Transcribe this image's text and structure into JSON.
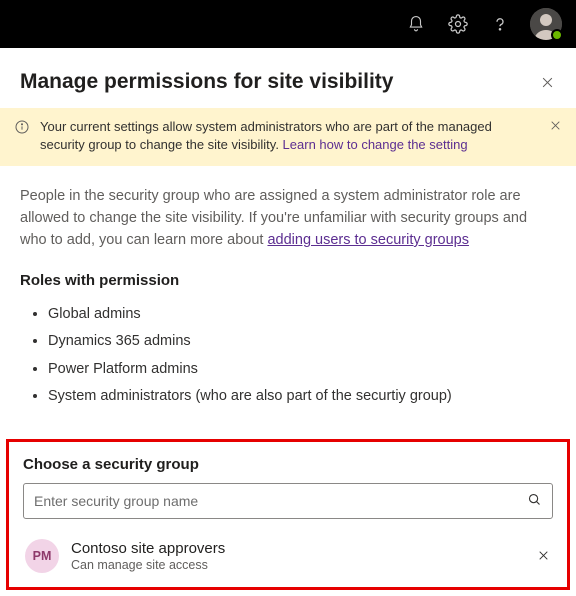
{
  "panel": {
    "title": "Manage permissions for site visibility"
  },
  "infoBar": {
    "text_before_link": "Your current settings allow system administrators who are part of the managed security group to change the site visibility. ",
    "link_text": "Learn how to change the setting"
  },
  "intro": {
    "text_before_link": "People in the security group who are assigned a system administrator role are allowed to change the site visibility. If you're unfamiliar with security groups and who to add, you can learn more about ",
    "link_text": "adding users to security groups"
  },
  "roles": {
    "heading": "Roles with permission",
    "items": [
      "Global admins",
      "Dynamics 365 admins",
      "Power Platform admins",
      "System administrators (who are also part of the securtiy group)"
    ]
  },
  "chooser": {
    "label": "Choose a security group",
    "placeholder": "Enter security group name"
  },
  "selectedGroup": {
    "initials": "PM",
    "name": "Contoso site approvers",
    "subtitle": "Can manage site access"
  }
}
